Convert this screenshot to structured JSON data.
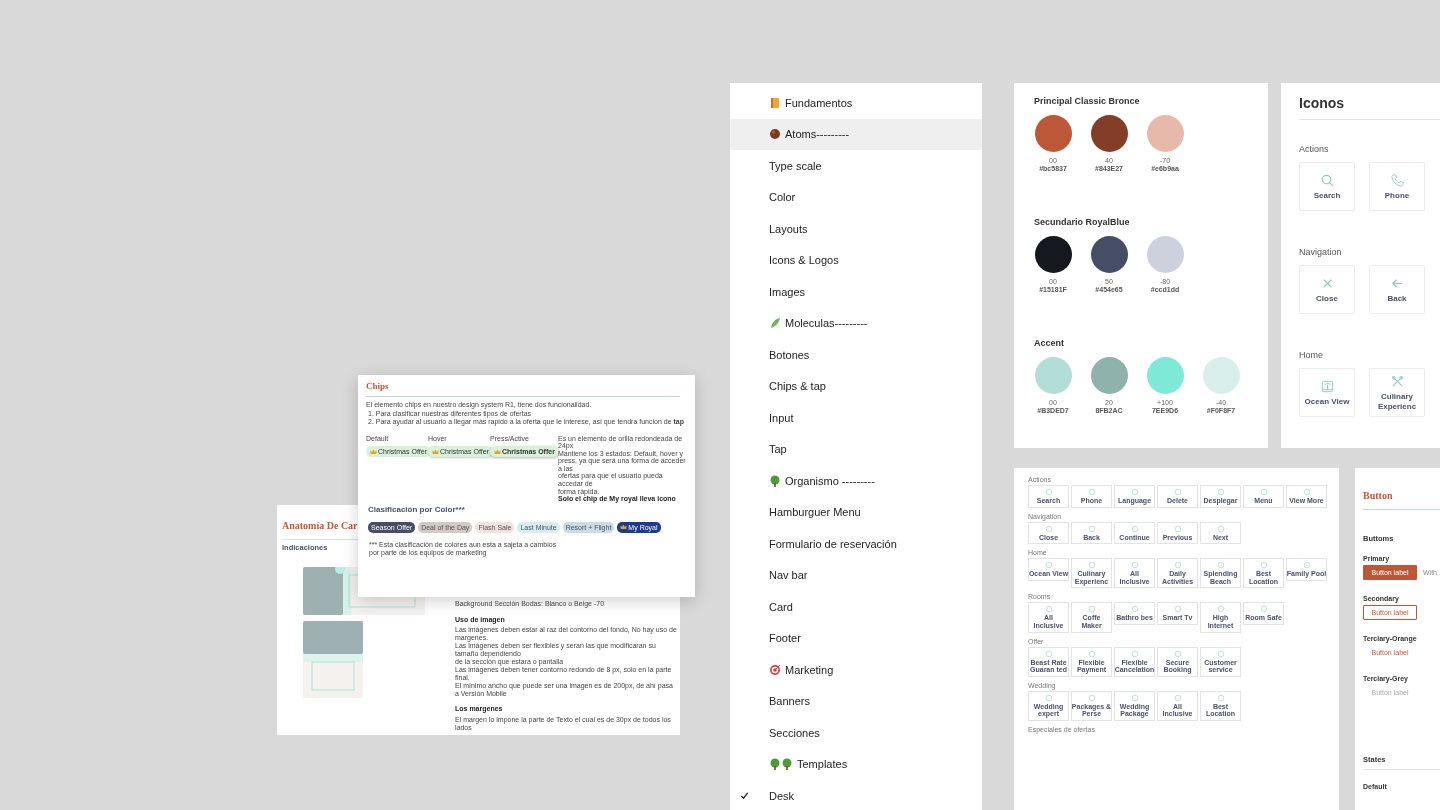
{
  "anatomy": {
    "title": "Anatomía De Car",
    "subtitle": "Indicaciones",
    "background_note": "Background Sección Bodas: Blanco o Beige -70",
    "image_heading": "Uso de imagen",
    "image_lines": [
      "Las imágenes deben estar al raz del contorno del fondo, No hay uso de margenes.",
      "Las imágenes deben ser flexibles y seran las que modificaran su tamaño dependiendo",
      "de la sección que estara o pantalla",
      "Las imágenes deben tener contorno redondo de 8 px, solo en la parte final.",
      "El mínimo ancho que puede ser una imagen es de 200px, de ahí pasa a Versión Mobile"
    ],
    "margin_heading": "Los margenes",
    "margin_text": "El margen lo impone la parte de Texto el cual es de 30px de todos los lados"
  },
  "chips_card": {
    "title": "Chips",
    "intro": "El elemento chips en nuestro design system R1, tiene dos funcionalidad.",
    "points": [
      "1. Para clasificar nuestras diferentes tipos de ofertas",
      "2. Para ayudar al usuario a llegar más rapido a la oferta que le interese, así que tendra funcion de **tap**"
    ],
    "states": [
      {
        "label": "Default",
        "chip": "Christmas Offer",
        "kind": "default"
      },
      {
        "label": "Hover",
        "chip": "Christmas Offer",
        "kind": "hover"
      },
      {
        "label": "Press/Active",
        "chip": "Christmas Offer",
        "kind": "pressed"
      }
    ],
    "note_lines": [
      "Es un elemento de orilla redondeada de 24px",
      "Mantiene los 3 estados: Default, hover y",
      "press, ya que será una forma de acceder a las",
      "ofertas para que el usuario pueda accedar de",
      "forma rápida."
    ],
    "note_bold": "Solo el chip de My royal lleva icono",
    "color_title": "Clasificación por Color***",
    "color_chips": [
      {
        "label": "Season Offer",
        "color": "#454e65",
        "icon": false
      },
      {
        "label": "Deal of the Day",
        "color": "#d6c9bf",
        "icon": false
      },
      {
        "label": "Flash Sale",
        "color": "#efe3da",
        "icon": false
      },
      {
        "label": "Last Minute",
        "color": "#d6efed",
        "icon": false
      },
      {
        "label": "Resort + Flight",
        "color": "#c9dde2",
        "icon": false
      },
      {
        "label": "My Royal",
        "color": "#1e3a8a",
        "icon": true
      }
    ],
    "footnote": [
      "*** Esta clasificación de colores aun esta a sajeta a cambios",
      "por parte de los equipos de marketing"
    ]
  },
  "sidebar": {
    "items": [
      {
        "label": "Fundamentos",
        "kind": "section",
        "selected": false,
        "checked": false
      },
      {
        "label": "Atoms---------",
        "kind": "section",
        "selected": true,
        "checked": false
      },
      {
        "label": "Type scale",
        "kind": "page",
        "selected": false,
        "checked": false
      },
      {
        "label": "Color",
        "kind": "page",
        "selected": false,
        "checked": false
      },
      {
        "label": "Layouts",
        "kind": "page",
        "selected": false,
        "checked": false
      },
      {
        "label": "Icons & Logos",
        "kind": "page",
        "selected": false,
        "checked": false
      },
      {
        "label": "Images",
        "kind": "page",
        "selected": false,
        "checked": false
      },
      {
        "label": "Moleculas---------",
        "kind": "section",
        "selected": false,
        "checked": false
      },
      {
        "label": "Botones",
        "kind": "page",
        "selected": false,
        "checked": false
      },
      {
        "label": "Chips & tap",
        "kind": "page",
        "selected": false,
        "checked": false
      },
      {
        "label": "Input",
        "kind": "page",
        "selected": false,
        "checked": false
      },
      {
        "label": "Tap",
        "kind": "page",
        "selected": false,
        "checked": false
      },
      {
        "label": "Organismo ---------",
        "kind": "section",
        "selected": false,
        "checked": false
      },
      {
        "label": "Hamburguer Menu",
        "kind": "page",
        "selected": false,
        "checked": false
      },
      {
        "label": "Formulario de reservación",
        "kind": "page",
        "selected": false,
        "checked": false
      },
      {
        "label": "Nav bar",
        "kind": "page",
        "selected": false,
        "checked": false
      },
      {
        "label": "Card",
        "kind": "page",
        "selected": false,
        "checked": false
      },
      {
        "label": "Footer",
        "kind": "page",
        "selected": false,
        "checked": false
      },
      {
        "label": "Marketing",
        "kind": "section",
        "selected": false,
        "checked": false
      },
      {
        "label": "Banners",
        "kind": "page",
        "selected": false,
        "checked": false
      },
      {
        "label": "Secciones",
        "kind": "page",
        "selected": false,
        "checked": false
      },
      {
        "label": "Templates",
        "kind": "section",
        "selected": false,
        "checked": false
      },
      {
        "label": "Desk",
        "kind": "page",
        "selected": false,
        "checked": true
      }
    ]
  },
  "colors": {
    "groups": [
      {
        "title": "Principal Classic Bronce",
        "swatches": [
          {
            "step": "00",
            "hex": "#bc5837",
            "color": "#bc5837"
          },
          {
            "step": "40",
            "hex": "#843E27",
            "color": "#843e27"
          },
          {
            "step": "-70",
            "hex": "#e6b9aa",
            "color": "#e6b9aa"
          }
        ]
      },
      {
        "title": "Secundario RoyalBlue",
        "swatches": [
          {
            "step": "00",
            "hex": "#15181F",
            "color": "#15181f"
          },
          {
            "step": "50",
            "hex": "#454e65",
            "color": "#454e65"
          },
          {
            "step": "-80",
            "hex": "#ccd1dd",
            "color": "#ccd1dd"
          }
        ]
      },
      {
        "title": "Accent",
        "swatches": [
          {
            "step": "00",
            "hex": "#B3DED7",
            "color": "#b3ded7"
          },
          {
            "step": "20",
            "hex": "8FB2AC",
            "color": "#8fb2ac"
          },
          {
            "step": "+100",
            "hex": "7EE9D6",
            "color": "#7ee9d6"
          },
          {
            "step": "-40",
            "hex": "#F0F8F7",
            "color": "#d8eeea"
          }
        ]
      }
    ]
  },
  "iconos": {
    "title": "Iconos",
    "sections": [
      {
        "title": "Actions",
        "tiles": [
          "Search",
          "Phone"
        ]
      },
      {
        "title": "Navigation",
        "tiles": [
          "Close",
          "Back"
        ]
      },
      {
        "title": "Home",
        "tiles": [
          "Ocean View",
          "Culinary Experienc"
        ]
      }
    ]
  },
  "icon_sheet": {
    "sections": [
      {
        "title": "Actions",
        "tiles": [
          "Search",
          "Phone",
          "Language",
          "Delete",
          "Desplegar",
          "Menu",
          "View More"
        ]
      },
      {
        "title": "Navigation",
        "tiles": [
          "Close",
          "Back",
          "Continue",
          "Previous",
          "Next"
        ]
      },
      {
        "title": "Home",
        "tiles": [
          "Ocean View",
          "Culinary Experienc",
          "All Inclusive",
          "Daily Activities",
          "Splending Beach",
          "Best Location",
          "Family Pool"
        ]
      },
      {
        "title": "Rooms",
        "tiles": [
          "All Inclusive",
          "Coffe Maker",
          "Bathro bes",
          "Smart Tv",
          "High Internet",
          "Room Safe"
        ]
      },
      {
        "title": "Offer",
        "tiles": [
          "Beast Rate Guaran ted",
          "Flexible Payment",
          "Flexible Cancelation",
          "Secure Booking",
          "Customer service"
        ]
      },
      {
        "title": "Wedding",
        "tiles": [
          "Wedding expert",
          "Packages & Perse",
          "Wedding Package",
          "All Inclusive",
          "Best Location"
        ]
      },
      {
        "title": "Especiales de ofertas"
      }
    ]
  },
  "button_card": {
    "title": "Button",
    "heading": "Buttoms",
    "variants": [
      {
        "label": "Primary",
        "button": "Button label",
        "kind": "primary"
      },
      {
        "label": "Secondary",
        "button": "Button label",
        "kind": "secondary"
      },
      {
        "label": "Terciary-Orange",
        "button": "Button label",
        "kind": "orange"
      },
      {
        "label": "Terciary-Grey",
        "button": "Button label",
        "kind": "grey"
      }
    ],
    "column_2": "With",
    "states_heading": "States",
    "states_first": "Default"
  }
}
